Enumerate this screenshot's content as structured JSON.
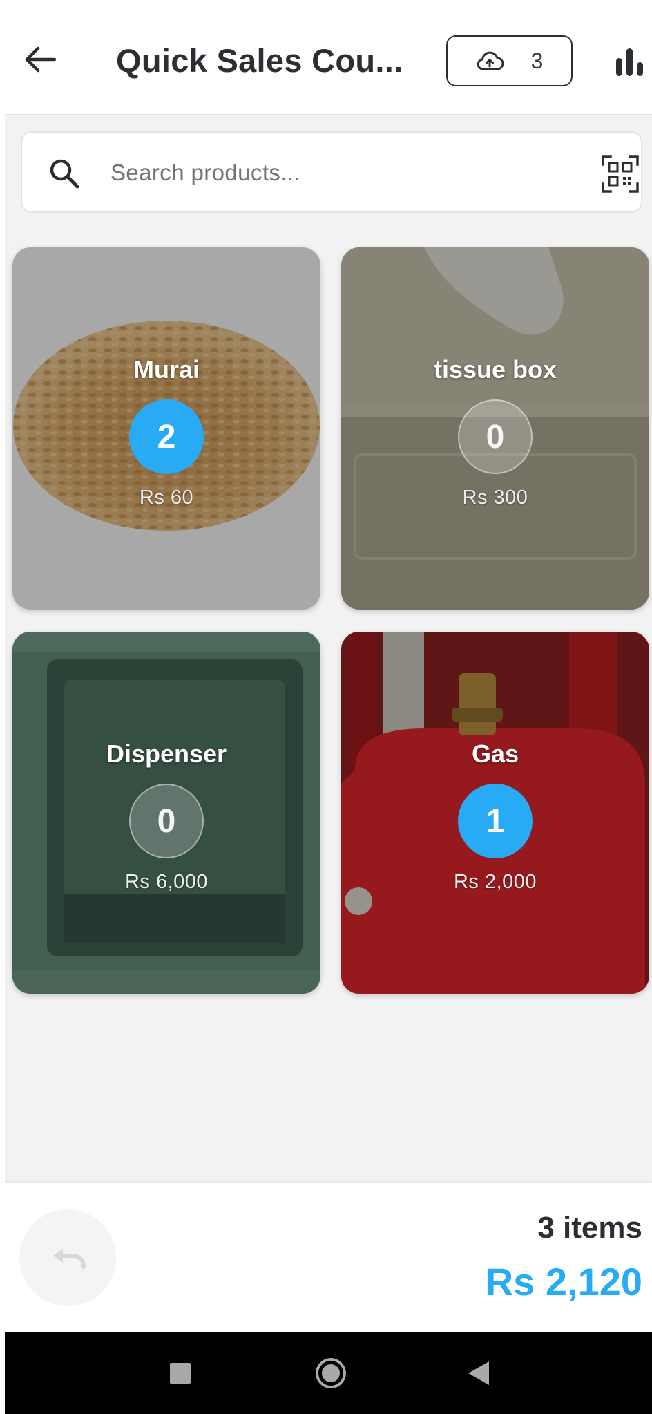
{
  "header": {
    "title": "Quick Sales Cou...",
    "sync_count": "3",
    "icons": {
      "back": "arrow-left-icon",
      "sync": "cloud-upload-icon",
      "stats": "bar-chart-icon"
    }
  },
  "search": {
    "placeholder": "Search products...",
    "value": "",
    "icons": {
      "search": "search-icon",
      "scan": "qr-scan-icon"
    }
  },
  "products": [
    {
      "name": "Murai",
      "quantity": "2",
      "price": "Rs 60",
      "selected": true
    },
    {
      "name": "tissue box",
      "quantity": "0",
      "price": "Rs 300",
      "selected": false
    },
    {
      "name": "Dispenser",
      "quantity": "0",
      "price": "Rs 6,000",
      "selected": false
    },
    {
      "name": "Gas",
      "quantity": "1",
      "price": "Rs 2,000",
      "selected": true
    }
  ],
  "summary": {
    "items": "3 items",
    "total": "Rs 2,120"
  },
  "colors": {
    "accent": "#29aaf5",
    "text": "#2b2f33",
    "background": "#f2f2f3"
  }
}
